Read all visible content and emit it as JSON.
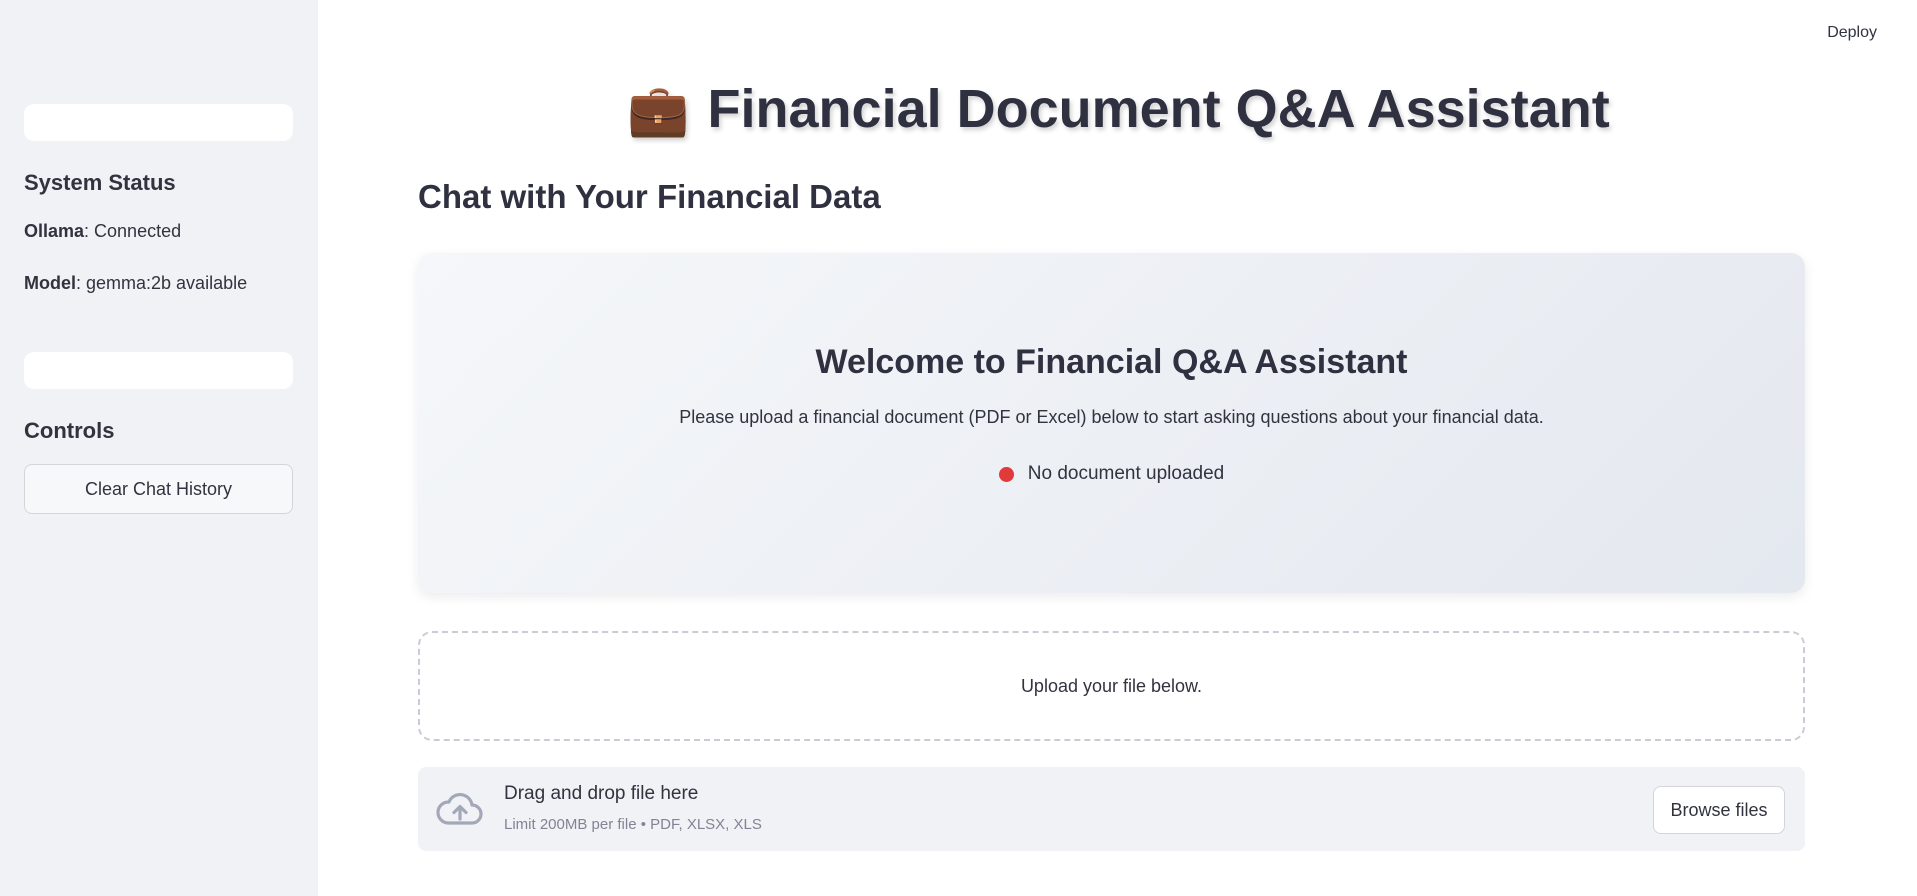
{
  "header": {
    "deploy_label": "Deploy"
  },
  "sidebar": {
    "status_heading": "System Status",
    "ollama_label": "Ollama",
    "ollama_value": ": Connected",
    "model_label": "Model",
    "model_value": ": gemma:2b available",
    "controls_heading": "Controls",
    "clear_button_label": "Clear Chat History"
  },
  "main": {
    "title_emoji": "💼",
    "title": "Financial Document Q&A Assistant",
    "subtitle": "Chat with Your Financial Data",
    "welcome": {
      "heading": "Welcome to Financial Q&A Assistant",
      "description": "Please upload a financial document (PDF or Excel) below to start asking questions about your financial data.",
      "status_text": "No document uploaded",
      "status_color": "#e03a3a"
    },
    "upload_note": "Upload your file below.",
    "uploader": {
      "icon": "cloud-upload-icon",
      "title": "Drag and drop file here",
      "limit": "Limit 200MB per file • PDF, XLSX, XLS",
      "browse_label": "Browse files"
    }
  }
}
